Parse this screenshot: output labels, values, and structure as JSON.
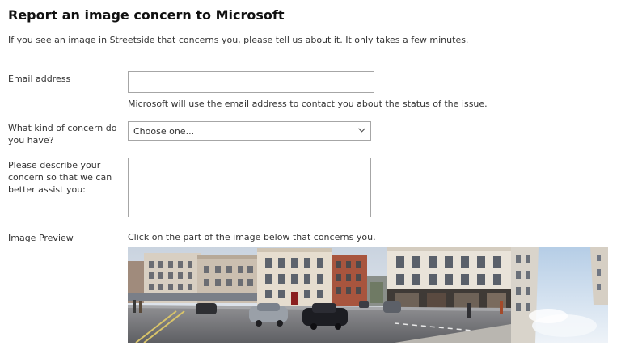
{
  "page": {
    "title": "Report an image concern to Microsoft",
    "intro": "If you see an image in Streetside that concerns you, please tell us about it. It only takes a few minutes."
  },
  "form": {
    "email": {
      "label": "Email address",
      "value": "",
      "help": "Microsoft will use the email address to contact you about the status of the issue."
    },
    "concern_type": {
      "label": "What kind of concern do you have?",
      "selected": "Choose one...",
      "icon": "chevron-down-icon"
    },
    "description": {
      "label": "Please describe your concern so that we can better assist you:",
      "value": ""
    },
    "preview": {
      "label": "Image Preview",
      "instruction": "Click on the part of the image below that concerns you.",
      "image_subject": "Streetside panorama of a city street with buildings and cars"
    }
  },
  "colors": {
    "input_border": "#a6a6a6",
    "text": "#333333",
    "title": "#111111"
  }
}
